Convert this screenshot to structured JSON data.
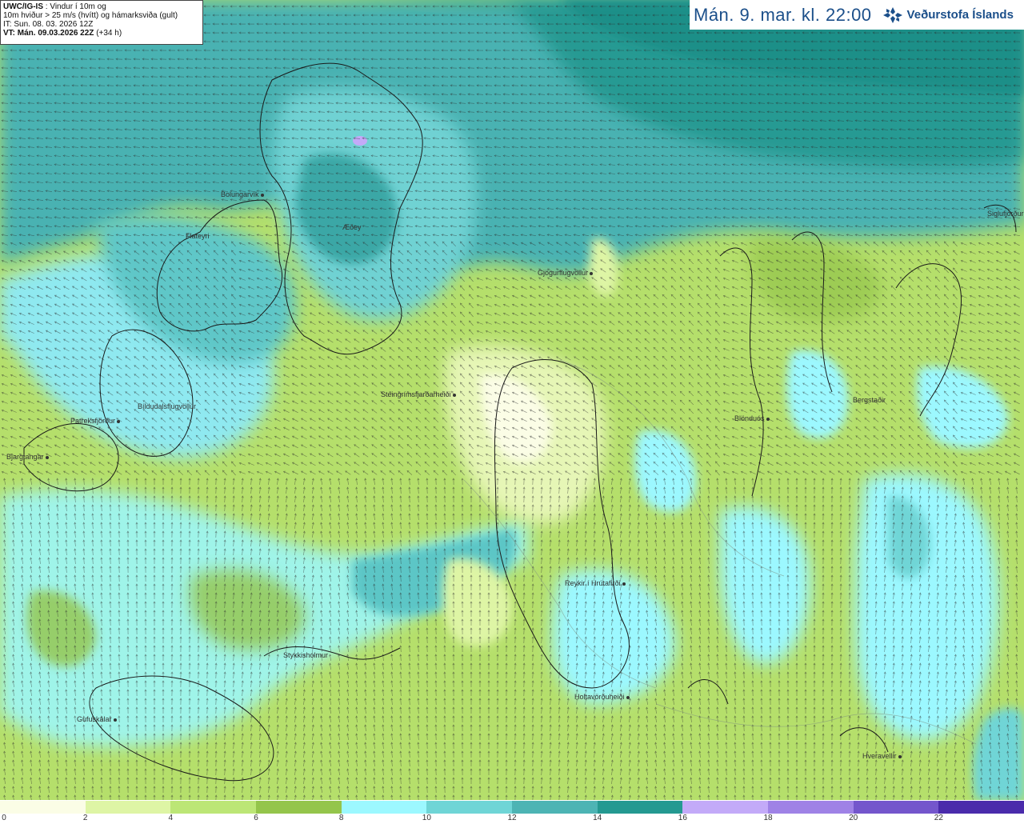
{
  "info": {
    "model": "UWC/IG-IS",
    "variable": ": Vindur í 10m og",
    "line2": "10m hviður > 25 m/s (hvítt) og hámarksviða (gult)",
    "it": "IT: Sun. 08. 03. 2026 12Z",
    "vt": "VT: Mán. 09.03.2026 22Z",
    "lead": "(+34 h)"
  },
  "header": {
    "title": "Mán. 9. mar. kl. 22:00",
    "logo_text": "Veðurstofa Íslands"
  },
  "places": [
    {
      "name": "Bolungarvík"
    },
    {
      "name": "Flateyri"
    },
    {
      "name": "Æðey"
    },
    {
      "name": "Gjögurflugvöllur"
    },
    {
      "name": "Siglufjörður"
    },
    {
      "name": "Steingrímsfjarðarheiði"
    },
    {
      "name": "Patreksfjörður"
    },
    {
      "name": "Bíldudalsflugvöllur"
    },
    {
      "name": "Bjargtangar"
    },
    {
      "name": "Blönduós"
    },
    {
      "name": "Bergstaðir"
    },
    {
      "name": "Reykir í Hrútafirði"
    },
    {
      "name": "Stykkishólmur"
    },
    {
      "name": "Holtavörðuheiði"
    },
    {
      "name": "Gufuskálar"
    },
    {
      "name": "Hveravellir"
    }
  ],
  "legend": {
    "ticks": [
      "0",
      "2",
      "4",
      "6",
      "8",
      "10",
      "12",
      "14",
      "16",
      "18",
      "20",
      "22"
    ],
    "colors": [
      "#fbfde6",
      "#def5a5",
      "#bce676",
      "#94c54b",
      "#9cf8ff",
      "#6fd5d6",
      "#4db4b4",
      "#249991",
      "#c3aaf8",
      "#9f82e6",
      "#7456cc",
      "#4a2bab"
    ]
  }
}
